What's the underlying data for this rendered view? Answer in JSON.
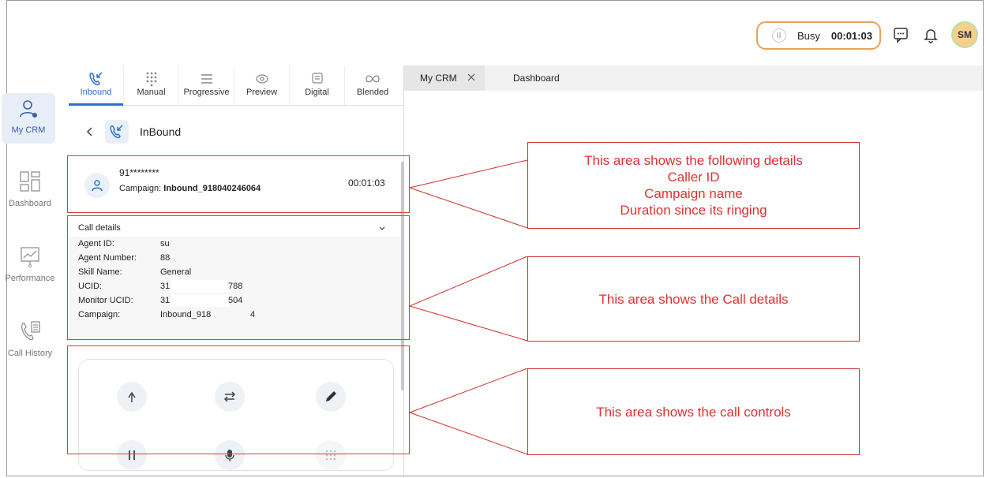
{
  "topbar": {
    "status": "Busy",
    "timer": "00:01:03",
    "avatar_initials": "SM"
  },
  "nav": {
    "items": [
      {
        "label": "My CRM",
        "icon": "agent-icon"
      },
      {
        "label": "Dashboard",
        "icon": "dashboard-grid-icon"
      },
      {
        "label": "Performance",
        "icon": "performance-chart-icon"
      },
      {
        "label": "Call History",
        "icon": "call-history-icon"
      }
    ]
  },
  "panel": {
    "tabs": [
      {
        "label": "Inbound",
        "icon": "inbound-call-icon"
      },
      {
        "label": "Manual",
        "icon": "dialpad-icon"
      },
      {
        "label": "Progressive",
        "icon": "list-icon"
      },
      {
        "label": "Preview",
        "icon": "eye-icon"
      },
      {
        "label": "Digital",
        "icon": "chat-icon"
      },
      {
        "label": "Blended",
        "icon": "infinity-icon"
      }
    ],
    "sub_title": "InBound",
    "caller_id": "91********",
    "campaign_label": "Campaign:",
    "campaign_name": "Inbound_918040246064",
    "duration": "00:01:03",
    "details_title": "Call details",
    "details": [
      {
        "key": "Agent ID:",
        "value": "su"
      },
      {
        "key": "Agent Number:",
        "value": "88"
      },
      {
        "key": "Skill Name:",
        "value": "General"
      },
      {
        "key": "UCID:",
        "value": "31",
        "value_tail": "788"
      },
      {
        "key": "Monitor UCID:",
        "value": "31",
        "value_tail": "504"
      },
      {
        "key": "Campaign:",
        "value": "Inbound_918",
        "value_tail": "4"
      }
    ],
    "controls": [
      "merge-icon",
      "transfer-icon",
      "edit-icon",
      "pause-icon",
      "mic-icon",
      "dialpad-icon"
    ]
  },
  "workspace_tabs": [
    {
      "label": "My CRM",
      "closable": true
    },
    {
      "label": "Dashboard",
      "closable": false
    }
  ],
  "annotations": [
    {
      "lines": [
        "This area shows the following details",
        "Caller ID",
        "Campaign name",
        "Duration since its ringing"
      ]
    },
    {
      "lines": [
        "This area shows the Call details"
      ]
    },
    {
      "lines": [
        "This area shows the call controls"
      ]
    }
  ],
  "colors": {
    "accent": "#2e6fd1",
    "annotation": "#e03030",
    "status_border": "#e8a25c"
  }
}
